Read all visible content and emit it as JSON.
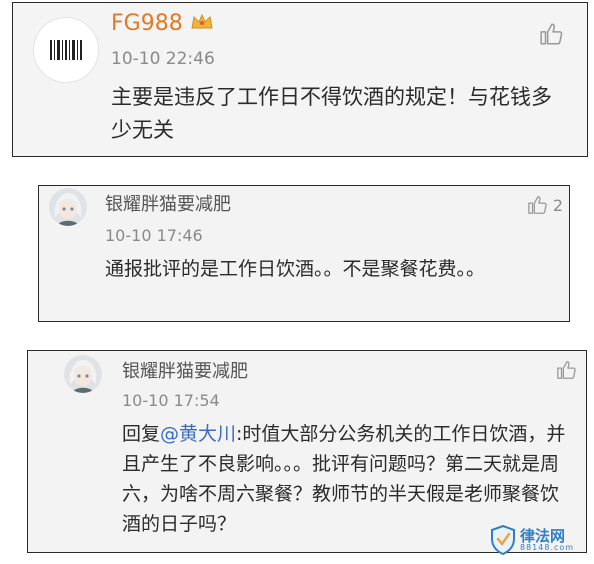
{
  "comments": [
    {
      "username": "FG988",
      "time": "10-10 22:46",
      "text": "主要是违反了工作日不得饮酒的规定！与花钱多少无关",
      "likes": ""
    },
    {
      "username": "银耀胖猫要减肥",
      "time": "10-10 17:46",
      "text": "通报批评的是工作日饮酒。。不是聚餐花费。。",
      "likes": "2"
    },
    {
      "username": "银耀胖猫要减肥",
      "time": "10-10 17:54",
      "reply_prefix": "回复",
      "mention": "@黄大川",
      "text": ":时值大部分公务机关的工作日饮酒，并且产生了不良影响。。。批评有问题吗？第二天就是周六，为啥不周六聚餐？教师节的半天假是老师聚餐饮酒的日子吗？",
      "likes": ""
    }
  ],
  "watermark": {
    "main": "律法网",
    "sub": "88148.com"
  },
  "icons": {
    "like": "thumbs-up-icon",
    "vip": "crown-icon",
    "avatar_barcode": "barcode-avatar",
    "avatar_character": "character-avatar"
  },
  "colors": {
    "username_vip": "#e07b25",
    "mention": "#3b6cc2",
    "timestamp": "#8a8a8a",
    "watermark": "#2f7fc7"
  }
}
